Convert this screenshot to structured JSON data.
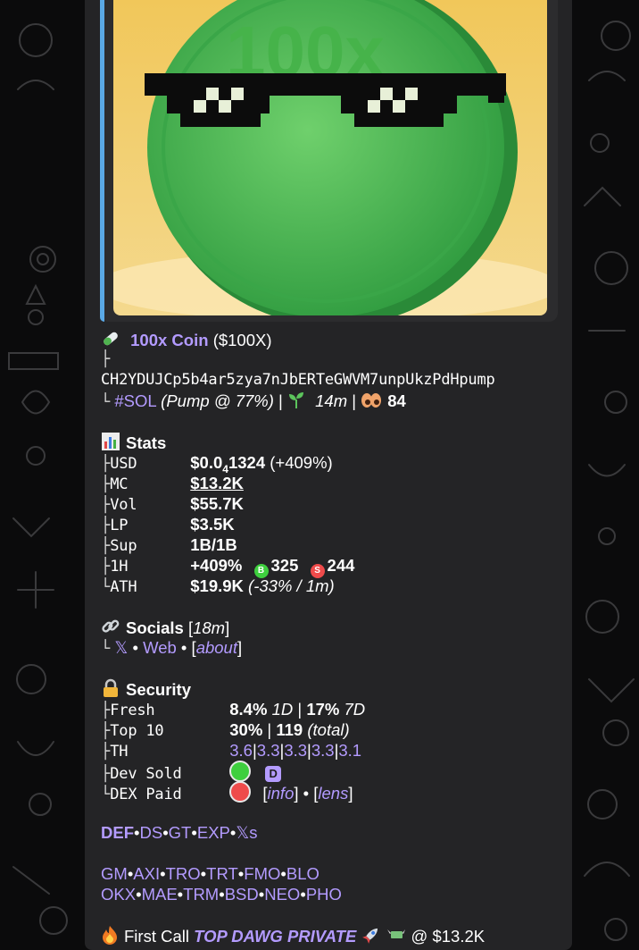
{
  "image": {
    "coin_text": "100x"
  },
  "header": {
    "name": "100x Coin",
    "ticker": "($100X)",
    "tree_top": "├",
    "address": "CH2YDUJCp5b4ar5zya7nJbERTeGWVM7unpUkzPdHpump",
    "tree_bottom": "└",
    "chain": "#SOL",
    "pump": "(Pump @ 77%)",
    "sep1": "|",
    "age": "14m",
    "sep2": "|",
    "eyes": "84"
  },
  "stats": {
    "title": "Stats",
    "rows": [
      {
        "tree": "├",
        "key": "USD",
        "v1": "$0.0",
        "v1_sub": "4",
        "v1b": "1324",
        "v2": " (+409%)"
      },
      {
        "tree": "├",
        "key": "MC",
        "v1": "$13.2K"
      },
      {
        "tree": "├",
        "key": "Vol",
        "v1": "$55.7K"
      },
      {
        "tree": "├",
        "key": "LP",
        "v1": "$3.5K"
      },
      {
        "tree": "├",
        "key": "Sup",
        "v1": "1B/1B"
      },
      {
        "tree": "├",
        "key": "1H",
        "v1": "+409%",
        "buy_badge": "B",
        "buys": "325",
        "sell_badge": "S",
        "sells": "244"
      },
      {
        "tree": "└",
        "key": "ATH",
        "v1": "$19.9K",
        "v2": "(-33% / 1m)"
      }
    ]
  },
  "socials": {
    "title": "Socials",
    "age": "18m",
    "tree": "└",
    "x": "𝕏",
    "dot1": "•",
    "web": "Web",
    "dot2": "•",
    "about": "about"
  },
  "security": {
    "title": "Security",
    "rows": [
      {
        "tree": "├",
        "key": "Fresh",
        "a": "8.4%",
        "a2": "1D",
        "sep": "|",
        "b": "17%",
        "b2": "7D"
      },
      {
        "tree": "├",
        "key": "Top 10",
        "a": "30%",
        "sep": "|",
        "b": "119",
        "b2": "(total)"
      },
      {
        "tree": "├",
        "key": "TH",
        "th": [
          "3.6",
          "3.3",
          "3.3",
          "3.3",
          "3.1"
        ]
      },
      {
        "tree": "├",
        "key": "Dev Sold",
        "badge": "D"
      },
      {
        "tree": "└",
        "key": "DEX Paid",
        "info": "info",
        "dot": "•",
        "lens": "lens"
      }
    ]
  },
  "links1": [
    "DEF",
    "DS",
    "GT",
    "EXP",
    "𝕏s"
  ],
  "links2": [
    "GM",
    "AXI",
    "TRO",
    "TRT",
    "FMO",
    "BLO"
  ],
  "links3": [
    "OKX",
    "MAE",
    "TRM",
    "BSD",
    "NEO",
    "PHO"
  ],
  "link_sep": "•",
  "first_call": {
    "label": "First Call",
    "group": "TOP DAWG PRIVATE",
    "at": "@ $13.2K"
  },
  "colors": {
    "link": "#b39bff",
    "bubble": "#242426",
    "green": "#3ecf3e",
    "red": "#ef4b4b",
    "accent": "#5aa9e6"
  }
}
